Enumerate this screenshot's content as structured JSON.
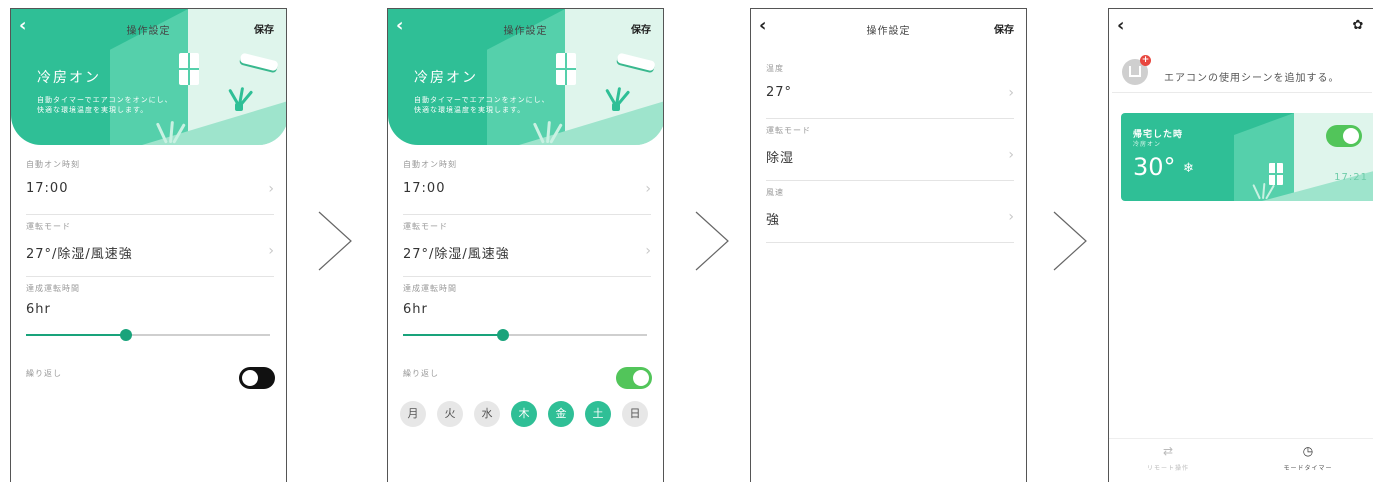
{
  "colors": {
    "accent": "#2fbf96",
    "toggle_on": "#52c55a",
    "slider": "#19a37b"
  },
  "icons": {
    "back": "chevron-left-icon",
    "next_step": "chevron-right-outline-icon",
    "row": "chevron-right-icon",
    "settings": "gear-icon",
    "snow": "snowflake-icon",
    "remote": "sliders-icon",
    "timer": "clock-icon"
  },
  "glyphs": {
    "back": "‹",
    "chevron": "›",
    "gear": "✿",
    "snow": "❄",
    "plus": "+",
    "remote": "⇄",
    "timer": "◷"
  },
  "screens": [
    {
      "nav": {
        "title": "操作設定",
        "save": "保存"
      },
      "hero": {
        "title": "冷房オン",
        "desc": "自動タイマーでエアコンをオンにし、快適な環境温度を実現します。"
      },
      "auto_on": {
        "label": "自動オン時刻",
        "value": "17:00"
      },
      "mode": {
        "label": "運転モード",
        "value": "27°/除湿/風速強"
      },
      "duration": {
        "label": "達成運転時間",
        "value": "6hr",
        "slider_fraction": 0.41
      },
      "repeat": {
        "label": "繰り返し",
        "on": false
      }
    },
    {
      "nav": {
        "title": "操作設定",
        "save": "保存"
      },
      "hero": {
        "title": "冷房オン",
        "desc": "自動タイマーでエアコンをオンにし、快適な環境温度を実現します。"
      },
      "auto_on": {
        "label": "自動オン時刻",
        "value": "17:00"
      },
      "mode": {
        "label": "運転モード",
        "value": "27°/除湿/風速強"
      },
      "duration": {
        "label": "達成運転時間",
        "value": "6hr",
        "slider_fraction": 0.41
      },
      "repeat": {
        "label": "繰り返し",
        "on": true
      },
      "days": [
        {
          "label": "月",
          "active": false
        },
        {
          "label": "火",
          "active": false
        },
        {
          "label": "水",
          "active": false
        },
        {
          "label": "木",
          "active": true
        },
        {
          "label": "金",
          "active": true
        },
        {
          "label": "土",
          "active": true
        },
        {
          "label": "日",
          "active": false
        }
      ]
    },
    {
      "nav": {
        "title": "操作設定",
        "save": "保存"
      },
      "rows": [
        {
          "label": "温度",
          "value": "27°"
        },
        {
          "label": "運転モード",
          "value": "除湿"
        },
        {
          "label": "風速",
          "value": "強"
        }
      ]
    },
    {
      "add_scene": {
        "text": "エアコンの使用シーンを追加する。"
      },
      "card": {
        "name": "帰宅した時",
        "sub": "冷房オン",
        "temp": "30°",
        "time": "17:21",
        "on": true
      },
      "tabs": [
        {
          "label": "リモート操作",
          "active": false
        },
        {
          "label": "モードタイマー",
          "active": true
        }
      ]
    }
  ]
}
